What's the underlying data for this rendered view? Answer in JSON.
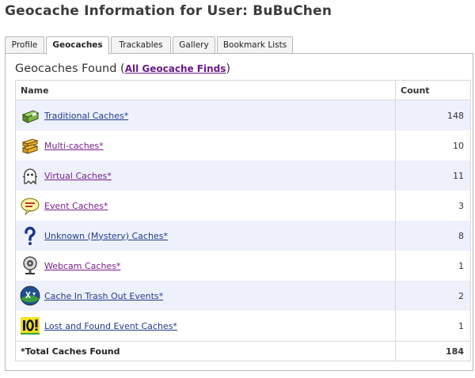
{
  "page": {
    "title": "Geocache Information for User: BuBuChen"
  },
  "tabs": [
    {
      "label": "Profile",
      "active": false
    },
    {
      "label": "Geocaches",
      "active": true
    },
    {
      "label": "Trackables",
      "active": false
    },
    {
      "label": "Gallery",
      "active": false
    },
    {
      "label": "Bookmark Lists",
      "active": false
    }
  ],
  "section": {
    "title": "Geocaches Found",
    "open_paren": "(",
    "link": "All Geocache Finds",
    "close_paren": ")"
  },
  "table": {
    "headers": {
      "name": "Name",
      "count": "Count"
    },
    "rows": [
      {
        "icon": "traditional-cache-icon",
        "label": "Traditional Caches*",
        "count": "148"
      },
      {
        "icon": "multi-cache-icon",
        "label": "Multi-caches*",
        "count": "10"
      },
      {
        "icon": "virtual-cache-icon",
        "label": "Virtual Caches*",
        "count": "11"
      },
      {
        "icon": "event-cache-icon",
        "label": "Event Caches*",
        "count": "3"
      },
      {
        "icon": "mystery-cache-icon",
        "label": "Unknown (Mystery) Caches*",
        "count": "8"
      },
      {
        "icon": "webcam-cache-icon",
        "label": "Webcam Caches*",
        "count": "1"
      },
      {
        "icon": "cito-event-icon",
        "label": "Cache In Trash Out Events*",
        "count": "2"
      },
      {
        "icon": "lost-and-found-event-icon",
        "label": "Lost and Found Event Caches*",
        "count": "1"
      }
    ],
    "total": {
      "label": "*Total Caches Found",
      "count": "184"
    }
  },
  "colors": {
    "link": "#1f3c8c",
    "visited_link": "#7a1e8e",
    "row_alt": "#eef1fb"
  }
}
